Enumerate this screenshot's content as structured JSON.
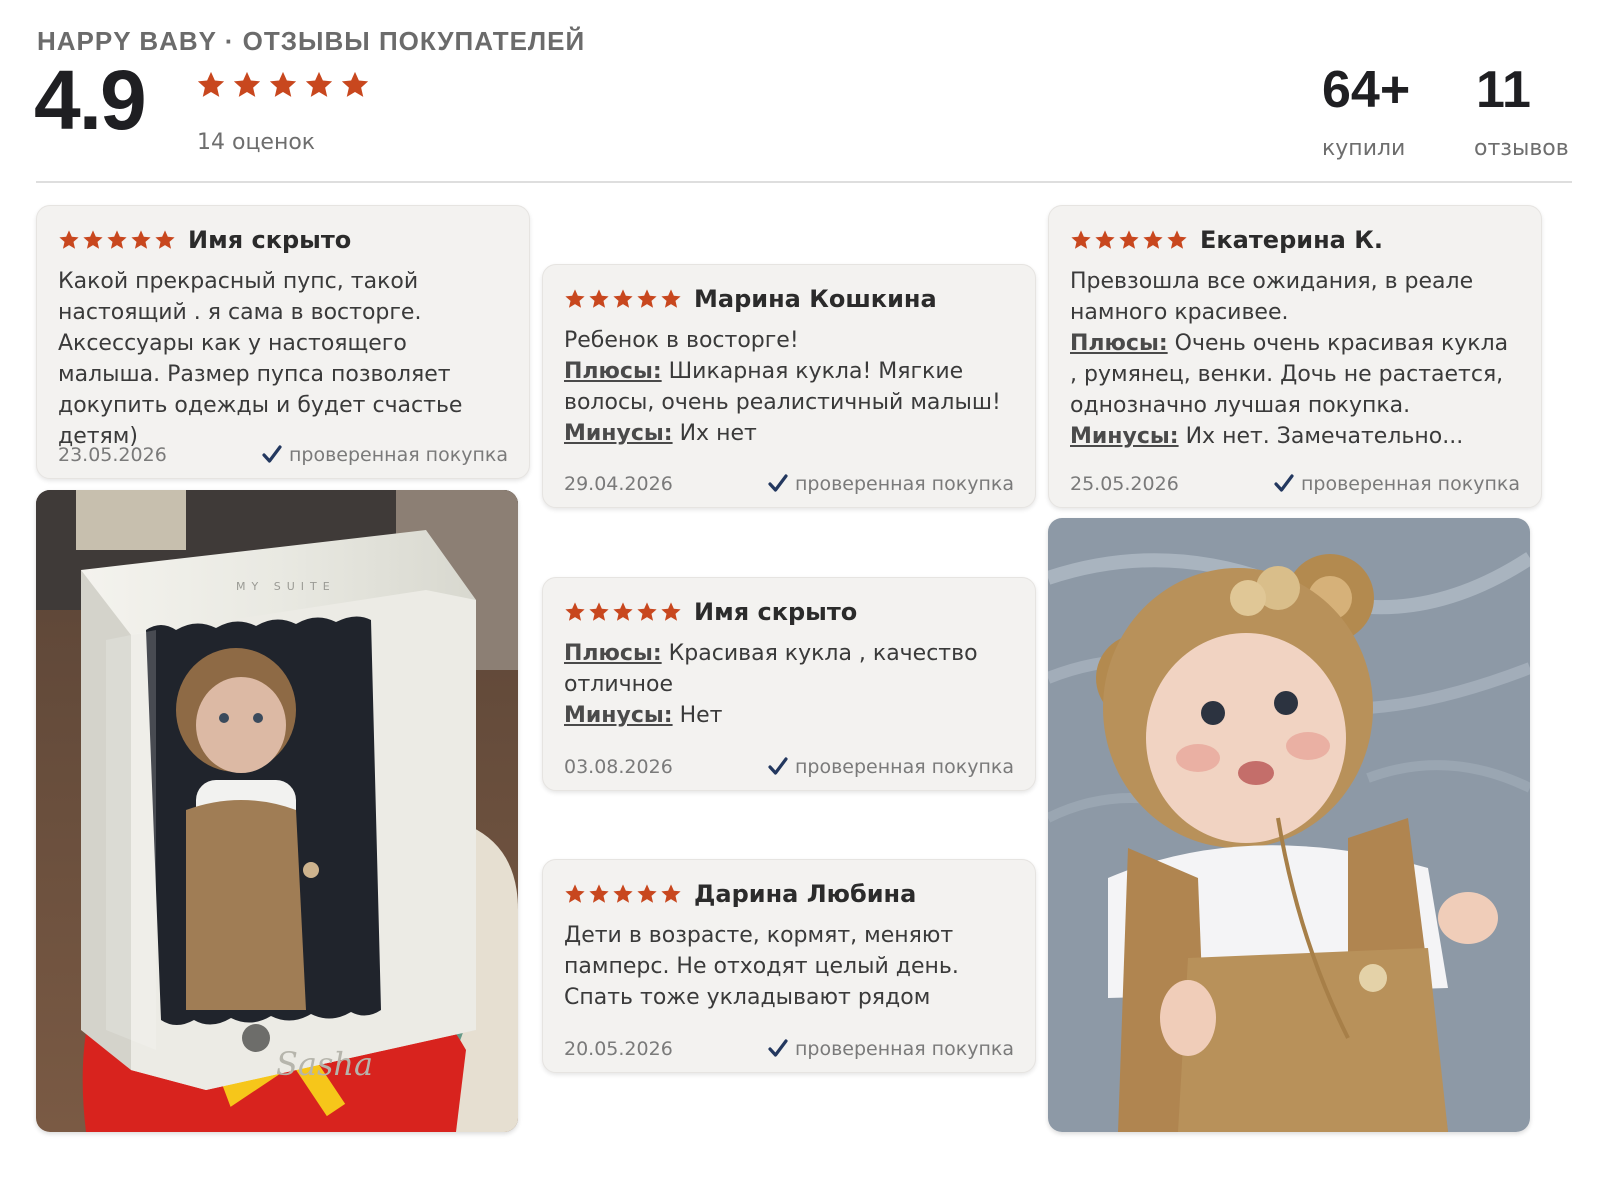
{
  "header": {
    "brand": "HAPPY BABY · ОТЗЫВЫ ПОКУПАТЕЛЕЙ",
    "rating": "4.9",
    "rating_count": "14 оценок",
    "bought_value": "64+",
    "bought_label": "купили",
    "reviews_value": "11",
    "reviews_label": "отзывов"
  },
  "colors": {
    "star": "#c8471e",
    "check": "#23385f",
    "card_bg": "#f3f2f0"
  },
  "verified_label": "проверенная покупка",
  "reviews": [
    {
      "rating": 5,
      "author": "Имя скрыто",
      "text": "Какой прекрасный пупс, такой настоящий . я сама в восторге. Аксессуары как у настоящего малыша. Размер пупса позволяет докупить одежды и будет счастье детям)",
      "date": "23.05.2026"
    },
    {
      "rating": 5,
      "author": "Марина Кошкина",
      "text": "Ребенок в восторге!",
      "pros_label": "Плюсы:",
      "pros": "Шикарная кукла! Мягкие волосы, очень реалистичный малыш!",
      "cons_label": "Минусы:",
      "cons": "Их нет",
      "date": "29.04.2026"
    },
    {
      "rating": 5,
      "author": "Екатерина К.",
      "text": "Превзошла все ожидания, в реале намного красивее.",
      "pros_label": "Плюсы:",
      "pros": "Очень очень красивая кукла , румянец, венки. Дочь не растается, однозначно лучшая покупка.",
      "cons_label": "Минусы:",
      "cons": "Их нет. Замечательно...",
      "date": "25.05.2026"
    },
    {
      "rating": 5,
      "author": "Имя скрыто",
      "pros_label": "Плюсы:",
      "pros": "Красивая кукла , качество отличное",
      "cons_label": "Минусы:",
      "cons": "Нет",
      "date": "03.08.2026"
    },
    {
      "rating": 5,
      "author": "Дарина Любина",
      "text": "Дети в возрасте, кормят, меняют памперс. Не отходят целый день. Спать тоже укладывают рядом",
      "date": "20.05.2026"
    }
  ],
  "photos": [
    {
      "icon": "boxed-doll-photo"
    },
    {
      "icon": "doll-bear-hat-photo"
    }
  ]
}
